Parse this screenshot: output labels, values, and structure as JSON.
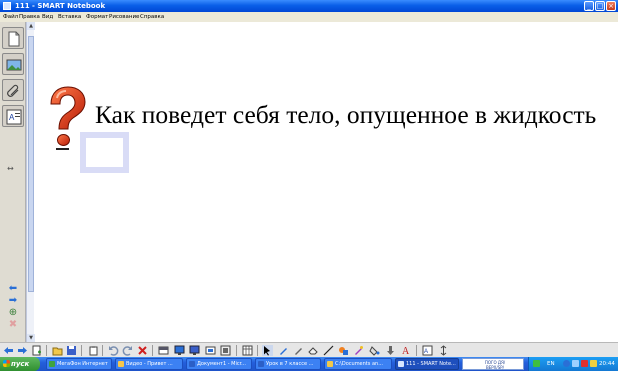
{
  "window": {
    "title": "111 - SMART Notebook",
    "controls": {
      "minimize": "_",
      "maximize": "□",
      "close": "×"
    }
  },
  "menu": [
    "Файл",
    "Правка",
    "Вид",
    "Вставка",
    "Формат",
    "Рисование",
    "Справка"
  ],
  "side_tabs": [
    "page-sorter-icon",
    "gallery-icon",
    "attachments-icon",
    "properties-icon"
  ],
  "side_resize": "↔",
  "canvas": {
    "text": "Как поведет себя тело, опущенное в жидкость"
  },
  "toolbar": {
    "icons": [
      "back-icon",
      "forward-icon",
      "add-page-icon",
      "open-icon",
      "save-icon",
      "paste-icon",
      "undo-icon",
      "redo-icon",
      "delete-icon",
      "screen-shade-icon",
      "full-screen-icon",
      "dual-page-icon",
      "screen-capture-icon",
      "document-camera-icon",
      "table-icon",
      "select-icon",
      "pen-icon",
      "creative-pen-icon",
      "eraser-icon",
      "line-icon",
      "shapes-icon",
      "magic-pen-icon",
      "fill-icon",
      "text-icon",
      "properties-icon",
      "move-toolbar-icon"
    ]
  },
  "taskbar": {
    "start_label": "пуск",
    "tasks": [
      {
        "label": "МегаФон Интернет",
        "color": "#3fa33f"
      },
      {
        "label": "Видео - Привет ...",
        "color": "#f7c64a"
      },
      {
        "label": "Документ1 - Micr...",
        "color": "#2b5fc7"
      },
      {
        "label": "Урок в 7 классе ...",
        "color": "#2b5fc7"
      },
      {
        "label": "C:\\Documents an...",
        "color": "#f2c84b"
      },
      {
        "label": "111 - SMART Note...",
        "color": "#d8e6ff"
      }
    ],
    "widget_text": "ПОГО ДЯ/ВЕРХ/SP/",
    "language": "EN",
    "clock": "20:44"
  }
}
